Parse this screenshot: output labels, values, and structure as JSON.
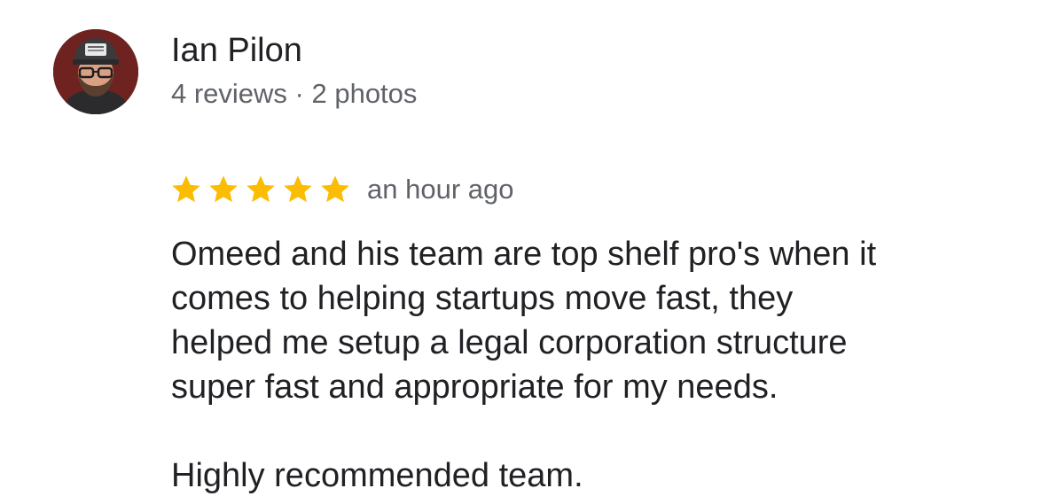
{
  "reviewer": {
    "name": "Ian Pilon",
    "meta": "4 reviews · 2 photos",
    "avatar_icon": "user-avatar-photo"
  },
  "review": {
    "rating": 5,
    "rating_max": 5,
    "star_color": "#fbbc04",
    "time": "an hour ago",
    "paragraph_1": "Omeed and his team are top shelf pro's when it\ncomes to helping startups move fast, they\nhelped me setup a legal corporation structure\nsuper fast and appropriate for my needs.",
    "paragraph_2": "Highly recommended team."
  }
}
